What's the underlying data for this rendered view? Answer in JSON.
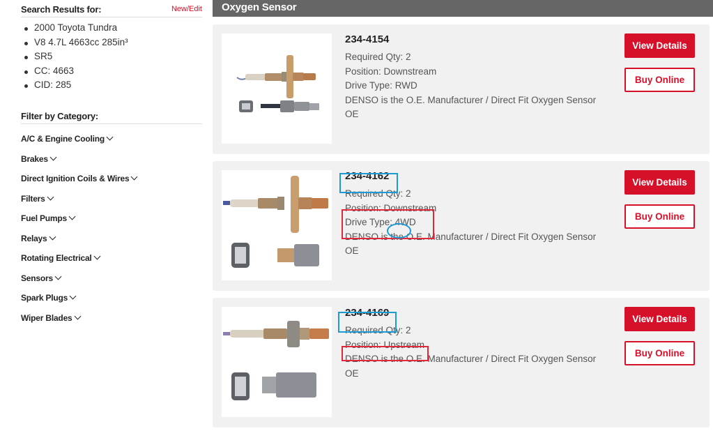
{
  "sidebar": {
    "search_title": "Search Results for:",
    "edit_link": "New/Edit",
    "vehicle": [
      "2000 Toyota Tundra",
      "V8 4.7L 4663cc 285in³",
      "SR5",
      "CC: 4663",
      "CID: 285"
    ],
    "filter_title": "Filter by Category:",
    "categories": [
      "A/C & Engine Cooling",
      "Brakes",
      "Direct Ignition Coils & Wires",
      "Filters",
      "Fuel Pumps",
      "Relays",
      "Rotating Electrical",
      "Sensors",
      "Spark Plugs",
      "Wiper Blades"
    ]
  },
  "header": {
    "title": "Oxygen Sensor"
  },
  "products": [
    {
      "part_number": "234-4154",
      "details": [
        "Required Qty: 2",
        "Position: Downstream",
        "Drive Type: RWD",
        "DENSO is the O.E. Manufacturer / Direct Fit Oxygen Sensor",
        "OE"
      ],
      "view_label": "View Details",
      "buy_label": "Buy Online"
    },
    {
      "part_number": "234-4162",
      "details": [
        "Required Qty: 2",
        "Position: Downstream",
        "Drive Type: 4WD",
        "DENSO is the O.E. Manufacturer / Direct Fit Oxygen Sensor",
        "OE"
      ],
      "view_label": "View Details",
      "buy_label": "Buy Online"
    },
    {
      "part_number": "234-4169",
      "details": [
        "Required Qty: 2",
        "Position: Upstream",
        "DENSO is the O.E. Manufacturer / Direct Fit Oxygen Sensor",
        "OE"
      ],
      "view_label": "View Details",
      "buy_label": "Buy Online"
    }
  ],
  "colors": {
    "accent": "#d7102a",
    "header_bg": "#666666",
    "card_bg": "#f1f1f1",
    "annotation_blue": "#1c9ad6",
    "annotation_red": "#e0283a"
  }
}
